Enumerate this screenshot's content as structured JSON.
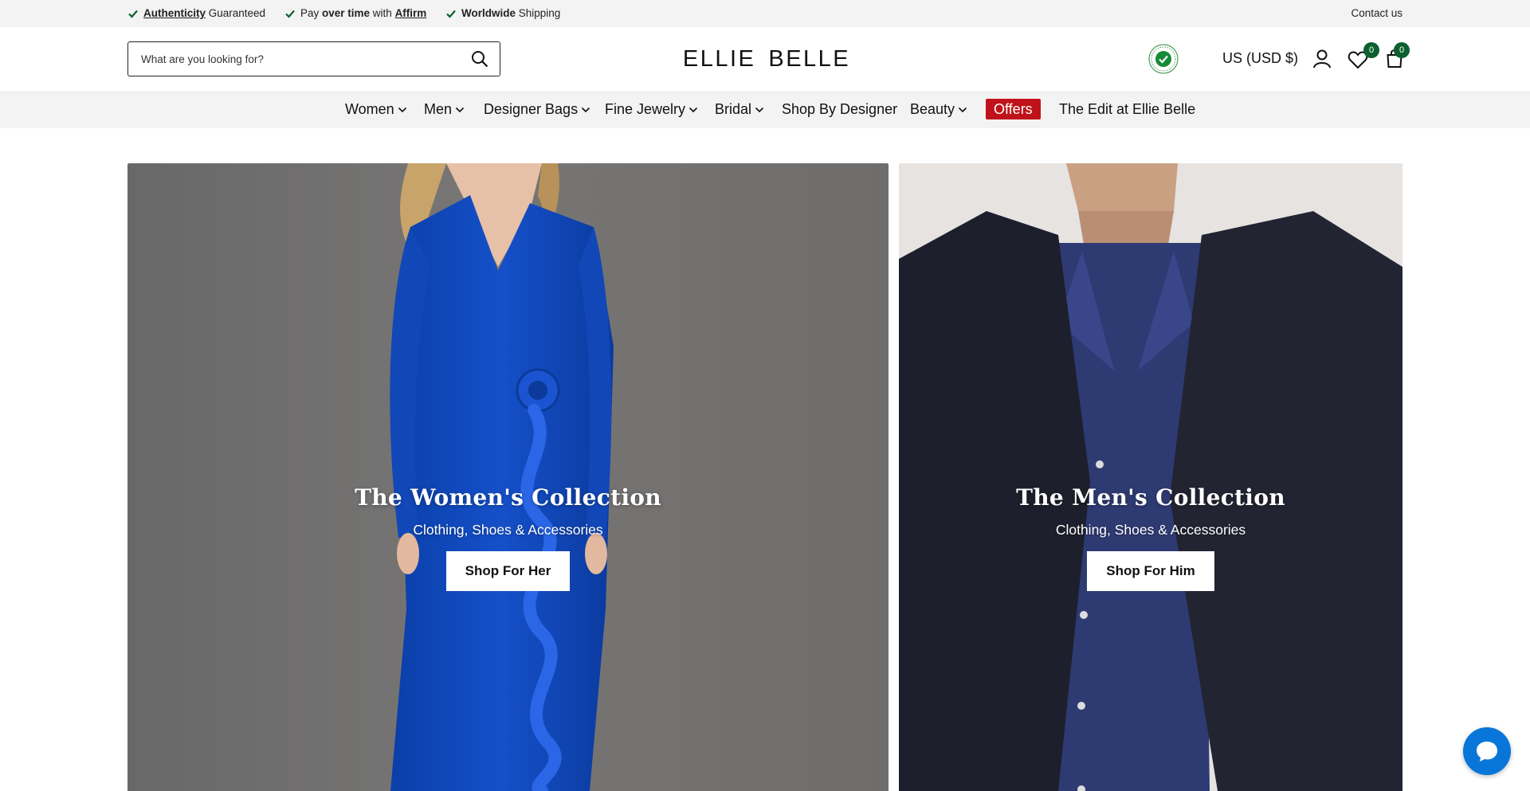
{
  "topbar": {
    "perks": [
      {
        "strong": "Authenticity",
        "rest": " Guaranteed"
      },
      {
        "pre": "Pay ",
        "bold": "over time",
        "mid": " with ",
        "link": "Affirm"
      },
      {
        "bold": "Worldwide",
        "rest": " Shipping"
      }
    ],
    "contact": "Contact us",
    "check_color": "#0d5f2f"
  },
  "header": {
    "search_placeholder": "What are you looking for?",
    "logo_left": "ELLIE",
    "logo_right": "BELLE",
    "currency": "US (USD $)",
    "wishlist_count": "0",
    "cart_count": "0",
    "seal_label": "AUTHENTICITY GUARANTEED",
    "icons": [
      "search-icon",
      "authenticity-seal-icon",
      "account-icon",
      "heart-icon",
      "shopping-bag-icon"
    ]
  },
  "nav": {
    "items": [
      {
        "label": "Women",
        "dropdown": true
      },
      {
        "label": "Men",
        "dropdown": true
      },
      {
        "label": "Designer Bags",
        "dropdown": true
      },
      {
        "label": "Fine Jewelry",
        "dropdown": true
      },
      {
        "label": "Bridal",
        "dropdown": true
      },
      {
        "label": "Shop By Designer",
        "dropdown": false
      },
      {
        "label": "Beauty",
        "dropdown": true
      },
      {
        "label": "Offers",
        "dropdown": false
      },
      {
        "label": "The Edit at Ellie Belle",
        "dropdown": false
      }
    ],
    "offers_color": "#c0121a"
  },
  "hero": {
    "women": {
      "title": "The Women's Collection",
      "subtitle": "Clothing, Shoes & Accessories",
      "button": "Shop For Her"
    },
    "men": {
      "title": "The Men's Collection",
      "subtitle": "Clothing, Shoes & Accessories",
      "button": "Shop For Him"
    }
  },
  "chat": {
    "icon": "chat-bubble-icon",
    "color": "#0876d8"
  }
}
